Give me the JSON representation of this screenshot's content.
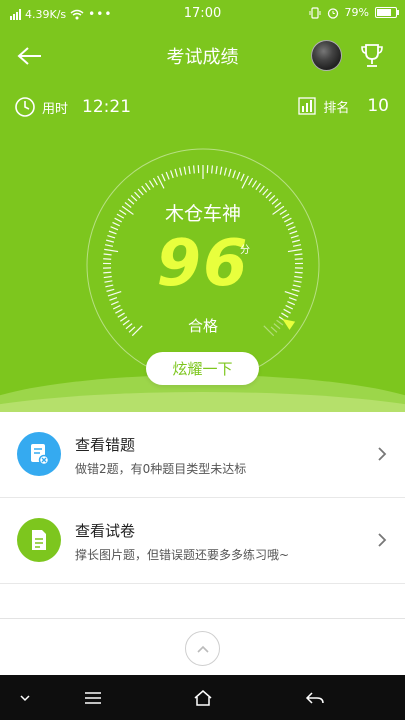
{
  "status_bar": {
    "net_speed": "4.39K/s",
    "time": "17:00",
    "battery": "79%"
  },
  "header": {
    "title": "考试成绩"
  },
  "stats": {
    "time_label": "用时",
    "time_value": "12:21",
    "rank_label": "排名",
    "rank_value": "10"
  },
  "gauge": {
    "name": "木仓车神",
    "score": "96",
    "unit": "分",
    "status": "合格",
    "progress": 0.96
  },
  "show_button": "炫耀一下",
  "list": [
    {
      "title": "查看错题",
      "subtitle": "做错2题，有0种题目类型未达标",
      "icon": "error-doc-icon",
      "color": "#35aaf0"
    },
    {
      "title": "查看试卷",
      "subtitle": "撑长图片题，但错误题还要多多练习哦~",
      "icon": "paper-doc-icon",
      "color": "#7dc61e"
    }
  ],
  "colors": {
    "primary_green": "#7dc61e",
    "score_yellow": "#e8ff3d",
    "blue": "#35aaf0"
  }
}
